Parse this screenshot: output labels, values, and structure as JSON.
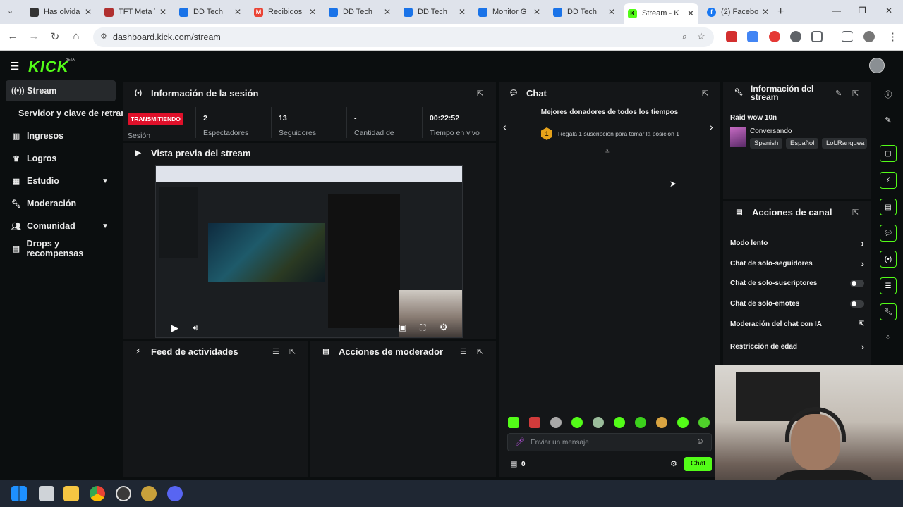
{
  "browser": {
    "tabs": [
      {
        "title": "Has olvida",
        "fav_color": "#333"
      },
      {
        "title": "TFT Meta T",
        "fav_color": "#b03030"
      },
      {
        "title": "DD Tech",
        "fav_color": "#1a73e8"
      },
      {
        "title": "Recibidos",
        "fav_color": "#ea4335"
      },
      {
        "title": "DD Tech",
        "fav_color": "#1a73e8"
      },
      {
        "title": "DD Tech",
        "fav_color": "#1a73e8"
      },
      {
        "title": "Monitor G",
        "fav_color": "#1a73e8"
      },
      {
        "title": "DD Tech",
        "fav_color": "#1a73e8"
      },
      {
        "title": "Stream - K",
        "fav_color": "#53fc18"
      },
      {
        "title": "(2) Facebo",
        "fav_color": "#1877f2"
      }
    ],
    "url": "dashboard.kick.com/stream"
  },
  "kick": {
    "logo": "KICK",
    "logo_badge": "BETA"
  },
  "sidebar": {
    "items": [
      {
        "label": "Stream",
        "icon": "stream-icon"
      },
      {
        "label": "Servidor y clave de retransmisión"
      },
      {
        "label": "Ingresos",
        "icon": "chart-icon"
      },
      {
        "label": "Logros",
        "icon": "trophy-icon"
      },
      {
        "label": "Estudio",
        "icon": "grid-icon"
      },
      {
        "label": "Moderación",
        "icon": "wrench-icon"
      },
      {
        "label": "Comunidad",
        "icon": "people-icon"
      },
      {
        "label": "Drops y recompensas",
        "icon": "gift-icon"
      }
    ]
  },
  "session": {
    "title": "Información de la sesión",
    "status": "TRANSMITIENDO",
    "status_label": "Sesión",
    "stats": [
      {
        "value": "2",
        "label": "Espectadores"
      },
      {
        "value": "13",
        "label": "Seguidores"
      },
      {
        "value": "-",
        "label": "Cantidad de"
      },
      {
        "value": "00:22:52",
        "label": "Tiempo en vivo"
      }
    ]
  },
  "preview": {
    "title": "Vista previa del stream"
  },
  "feed": {
    "title": "Feed de actividades"
  },
  "modactions": {
    "title": "Acciones de moderador"
  },
  "chat": {
    "title": "Chat",
    "donors_title": "Mejores donadores de todos los tiempos",
    "donor_rank": "1",
    "donor_text": "Regala 1 suscripción para tomar la posición 1",
    "placeholder": "Enviar un mensaje",
    "count": "0",
    "send_label": "Chat"
  },
  "stream_info": {
    "title": "Información del stream",
    "stream_title": "Raid wow 10n",
    "category": "Conversando",
    "tags": [
      "Spanish",
      "Español",
      "LoLRanquea"
    ]
  },
  "channel_actions": {
    "title": "Acciones de canal",
    "rows": [
      {
        "label": "Modo lento",
        "control": "chevron"
      },
      {
        "label": "Chat de solo-seguidores",
        "control": "chevron"
      },
      {
        "label": "Chat de solo-suscriptores",
        "control": "toggle"
      },
      {
        "label": "Chat de solo-emotes",
        "control": "toggle"
      },
      {
        "label": "Moderación del chat con IA",
        "control": "external"
      },
      {
        "label": "Restricción de edad",
        "control": "chevron"
      }
    ]
  },
  "colors": {
    "brand": "#53fc18",
    "live": "#e0102a"
  }
}
